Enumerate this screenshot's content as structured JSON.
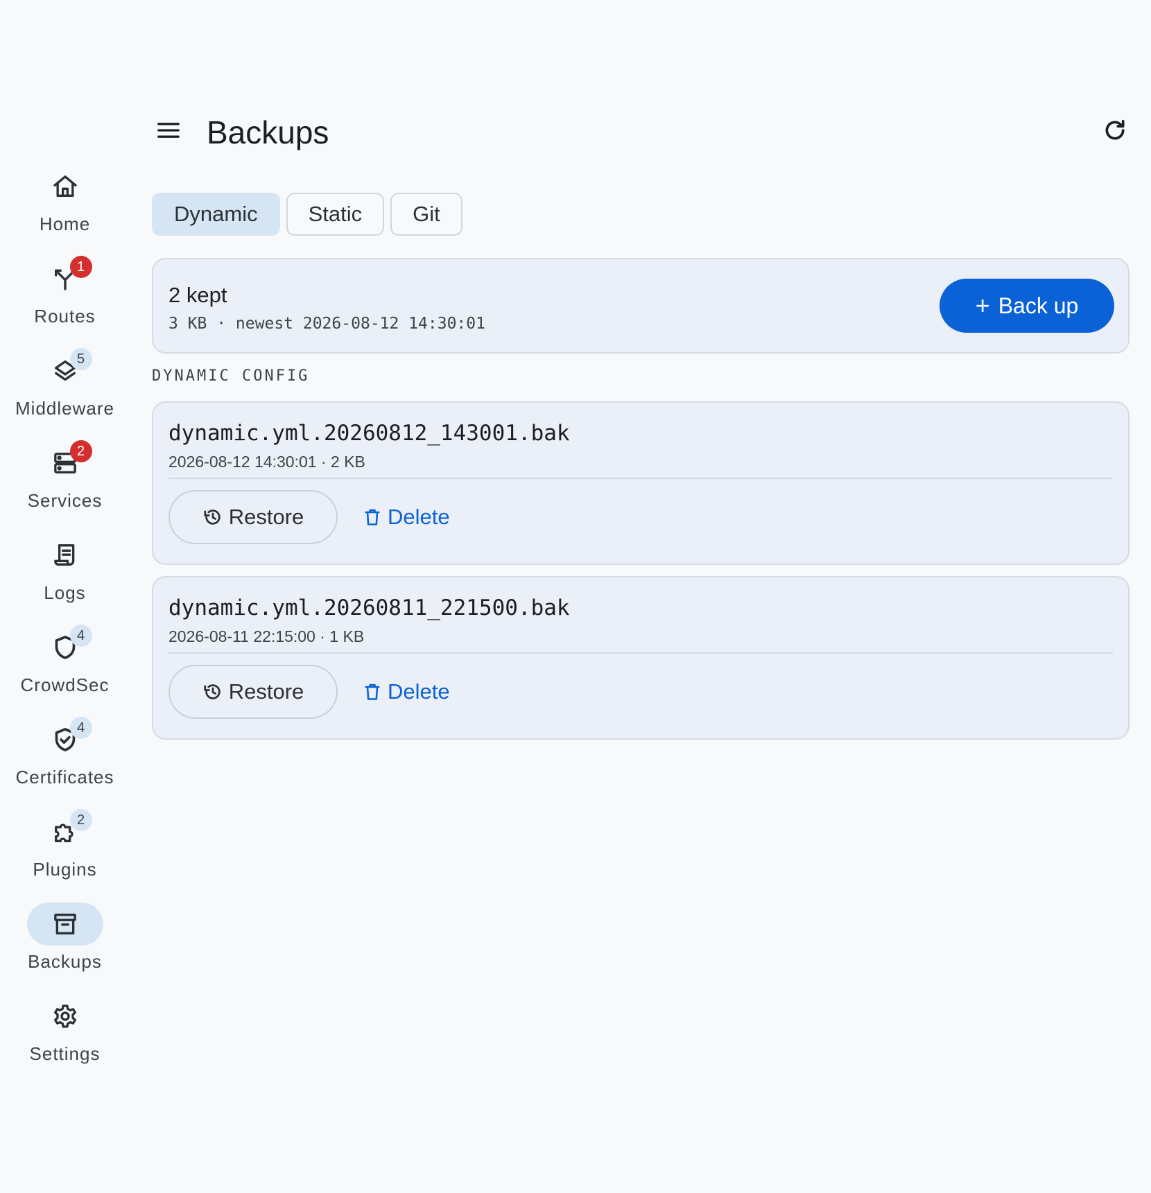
{
  "header": {
    "title": "Backups",
    "menu_icon": "menu-icon",
    "refresh_icon": "refresh-icon"
  },
  "sidebar": {
    "items": [
      {
        "label": "Home",
        "icon": "home-icon",
        "badge": null
      },
      {
        "label": "Routes",
        "icon": "routes-icon",
        "badge": "1",
        "badge_tone": "error"
      },
      {
        "label": "Middleware",
        "icon": "layers-icon",
        "badge": "5",
        "badge_tone": "info"
      },
      {
        "label": "Services",
        "icon": "server-icon",
        "badge": "2",
        "badge_tone": "error"
      },
      {
        "label": "Logs",
        "icon": "logs-icon",
        "badge": null
      },
      {
        "label": "CrowdSec",
        "icon": "shield-icon",
        "badge": "4",
        "badge_tone": "info"
      },
      {
        "label": "Certificates",
        "icon": "shield-check-icon",
        "badge": "4",
        "badge_tone": "info"
      },
      {
        "label": "Plugins",
        "icon": "puzzle-icon",
        "badge": "2",
        "badge_tone": "info"
      },
      {
        "label": "Backups",
        "icon": "archive-icon",
        "badge": null,
        "active": true
      },
      {
        "label": "Settings",
        "icon": "gear-icon",
        "badge": null
      }
    ]
  },
  "tabs": [
    {
      "label": "Dynamic",
      "active": true
    },
    {
      "label": "Static",
      "active": false
    },
    {
      "label": "Git",
      "active": false
    }
  ],
  "summary": {
    "count_text": "2 kept",
    "meta_text": "3 KB · newest 2026-08-12 14:30:01",
    "backup_button": "Back up"
  },
  "section_label": "DYNAMIC CONFIG",
  "backups": [
    {
      "name": "dynamic.yml.20260812_143001.bak",
      "meta": "2026-08-12 14:30:01 · 2 KB",
      "restore_label": "Restore",
      "delete_label": "Delete"
    },
    {
      "name": "dynamic.yml.20260811_221500.bak",
      "meta": "2026-08-11 22:15:00 · 1 KB",
      "restore_label": "Restore",
      "delete_label": "Delete"
    }
  ],
  "colors": {
    "accent": "#0b62d6",
    "badge_error": "#d32f2f",
    "active_pill": "#d6e5f3",
    "card_bg": "#ebeff7",
    "page_bg": "#f7f9fb"
  }
}
